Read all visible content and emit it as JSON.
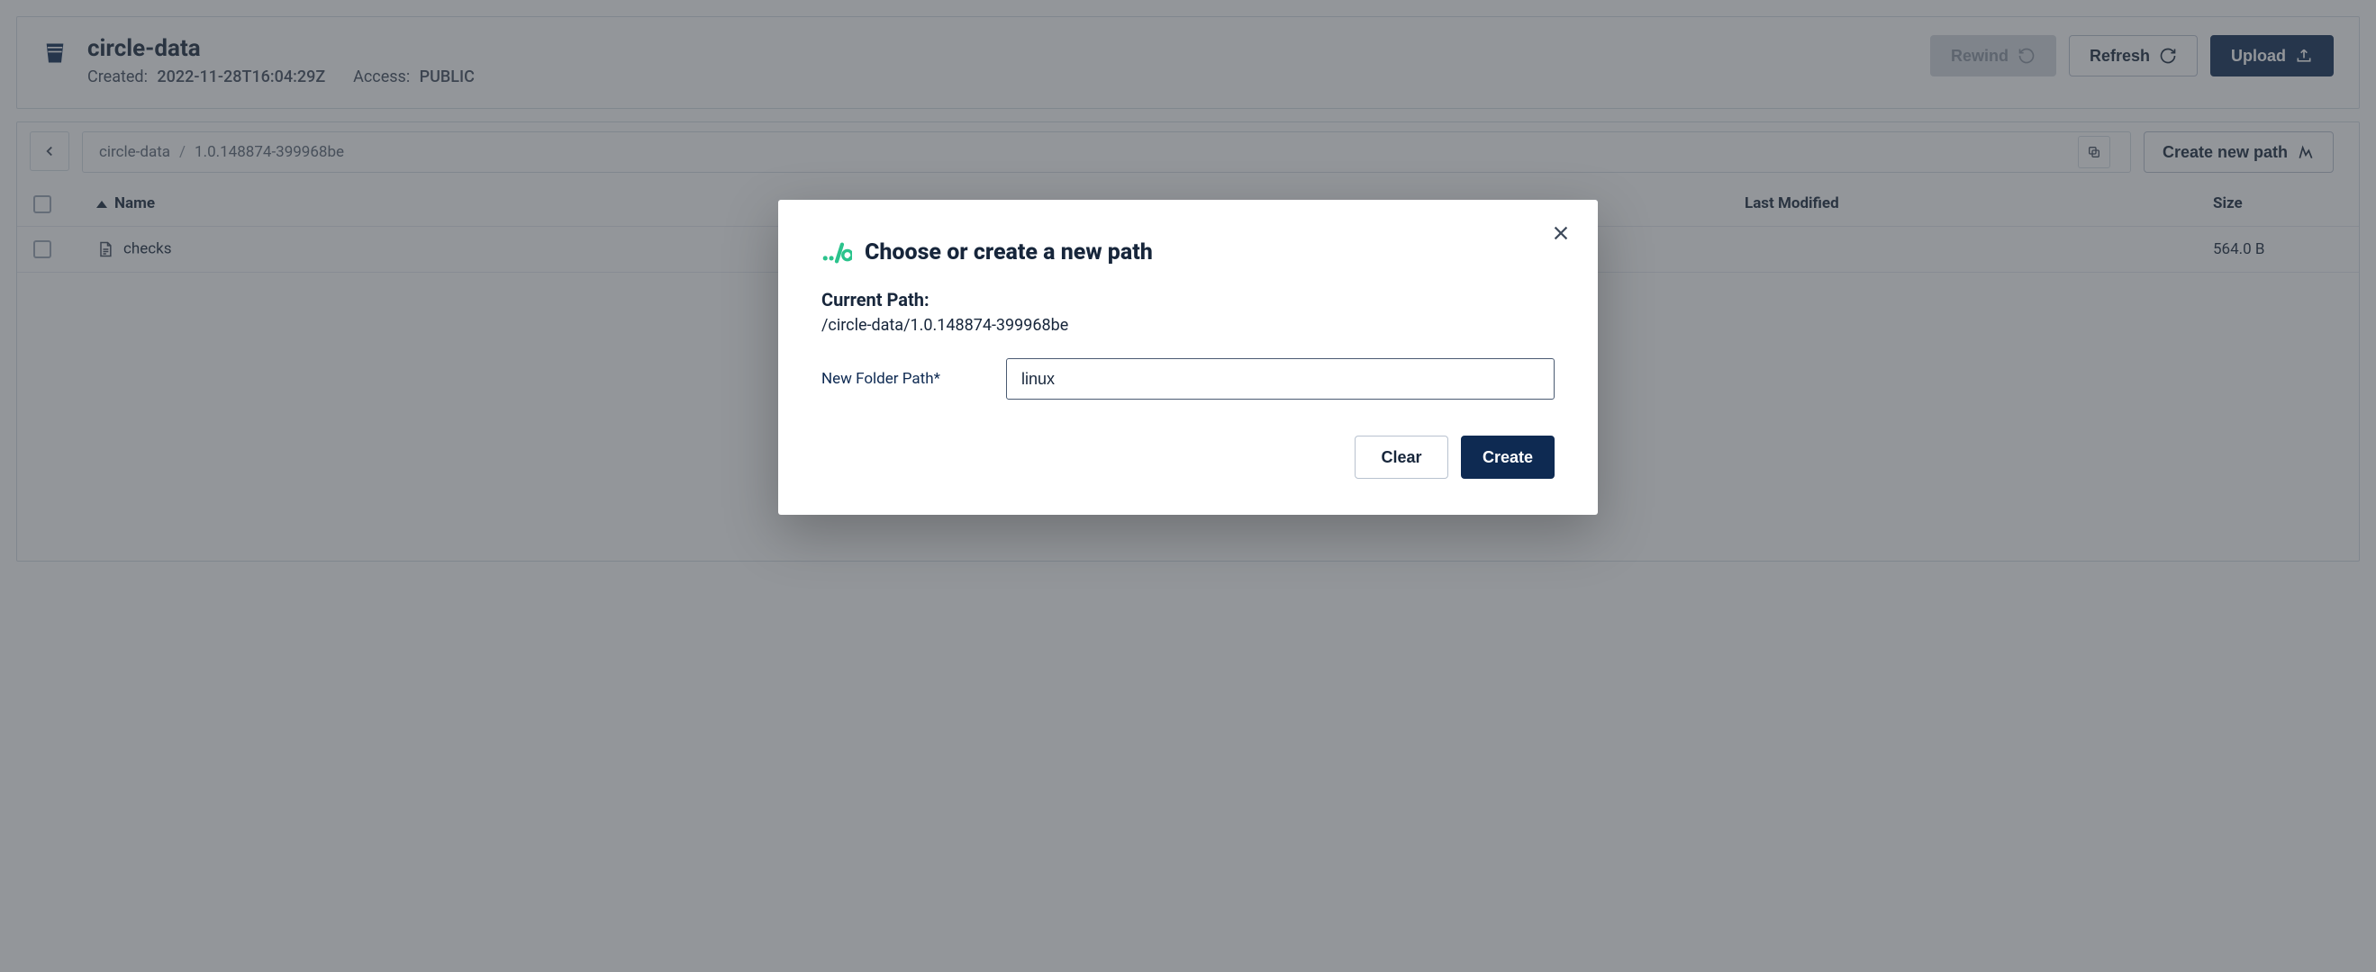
{
  "bucket": {
    "name": "circle-data",
    "created_label": "Created:",
    "created_value": "2022-11-28T16:04:29Z",
    "access_label": "Access:",
    "access_value": "PUBLIC"
  },
  "header_buttons": {
    "rewind": "Rewind",
    "refresh": "Refresh",
    "upload": "Upload"
  },
  "breadcrumb": {
    "root": "circle-data",
    "separator": "/",
    "segment": "1.0.148874-399968be"
  },
  "toolbar": {
    "create_new_path": "Create new path"
  },
  "table": {
    "columns": {
      "name": "Name",
      "last_modified": "Last Modified",
      "size": "Size"
    },
    "rows": [
      {
        "name": "checks",
        "size": "564.0 B"
      }
    ]
  },
  "modal": {
    "title": "Choose or create a new path",
    "current_path_label": "Current Path:",
    "current_path_value": "/circle-data/1.0.148874-399968be",
    "new_folder_label": "New Folder Path*",
    "new_folder_value": "linux",
    "clear": "Clear",
    "create": "Create"
  }
}
